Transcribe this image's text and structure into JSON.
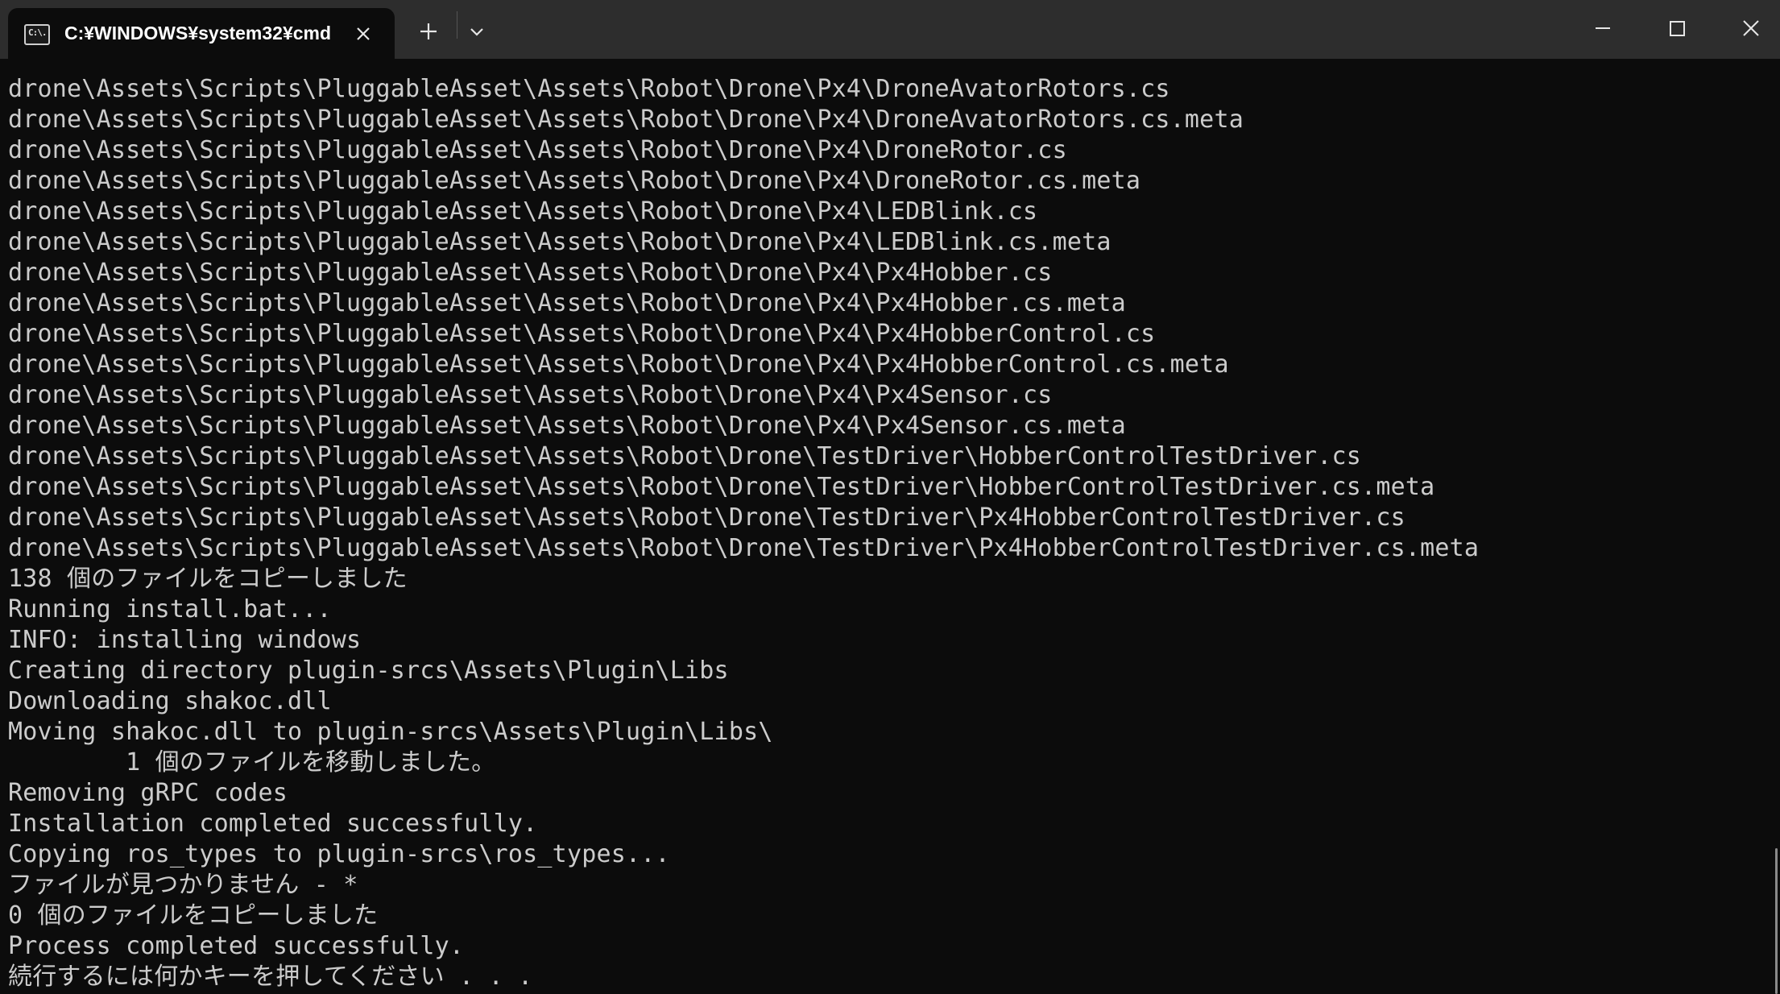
{
  "window": {
    "tab_title": "C:¥WINDOWS¥system32¥cmd",
    "tab_icon_text": "C:\\."
  },
  "console": {
    "lines": [
      "drone\\Assets\\Scripts\\PluggableAsset\\Assets\\Robot\\Drone\\Px4\\DroneAvatorRotors.cs",
      "drone\\Assets\\Scripts\\PluggableAsset\\Assets\\Robot\\Drone\\Px4\\DroneAvatorRotors.cs.meta",
      "drone\\Assets\\Scripts\\PluggableAsset\\Assets\\Robot\\Drone\\Px4\\DroneRotor.cs",
      "drone\\Assets\\Scripts\\PluggableAsset\\Assets\\Robot\\Drone\\Px4\\DroneRotor.cs.meta",
      "drone\\Assets\\Scripts\\PluggableAsset\\Assets\\Robot\\Drone\\Px4\\LEDBlink.cs",
      "drone\\Assets\\Scripts\\PluggableAsset\\Assets\\Robot\\Drone\\Px4\\LEDBlink.cs.meta",
      "drone\\Assets\\Scripts\\PluggableAsset\\Assets\\Robot\\Drone\\Px4\\Px4Hobber.cs",
      "drone\\Assets\\Scripts\\PluggableAsset\\Assets\\Robot\\Drone\\Px4\\Px4Hobber.cs.meta",
      "drone\\Assets\\Scripts\\PluggableAsset\\Assets\\Robot\\Drone\\Px4\\Px4HobberControl.cs",
      "drone\\Assets\\Scripts\\PluggableAsset\\Assets\\Robot\\Drone\\Px4\\Px4HobberControl.cs.meta",
      "drone\\Assets\\Scripts\\PluggableAsset\\Assets\\Robot\\Drone\\Px4\\Px4Sensor.cs",
      "drone\\Assets\\Scripts\\PluggableAsset\\Assets\\Robot\\Drone\\Px4\\Px4Sensor.cs.meta",
      "drone\\Assets\\Scripts\\PluggableAsset\\Assets\\Robot\\Drone\\TestDriver\\HobberControlTestDriver.cs",
      "drone\\Assets\\Scripts\\PluggableAsset\\Assets\\Robot\\Drone\\TestDriver\\HobberControlTestDriver.cs.meta",
      "drone\\Assets\\Scripts\\PluggableAsset\\Assets\\Robot\\Drone\\TestDriver\\Px4HobberControlTestDriver.cs",
      "drone\\Assets\\Scripts\\PluggableAsset\\Assets\\Robot\\Drone\\TestDriver\\Px4HobberControlTestDriver.cs.meta",
      "138 個のファイルをコピーしました",
      "Running install.bat...",
      "INFO: installing windows",
      "Creating directory plugin-srcs\\Assets\\Plugin\\Libs",
      "Downloading shakoc.dll",
      "Moving shakoc.dll to plugin-srcs\\Assets\\Plugin\\Libs\\",
      "        1 個のファイルを移動しました。",
      "Removing gRPC codes",
      "Installation completed successfully.",
      "Copying ros_types to plugin-srcs\\ros_types...",
      "ファイルが見つかりません - *",
      "0 個のファイルをコピーしました",
      "Process completed successfully.",
      "続行するには何かキーを押してください . . ."
    ]
  }
}
